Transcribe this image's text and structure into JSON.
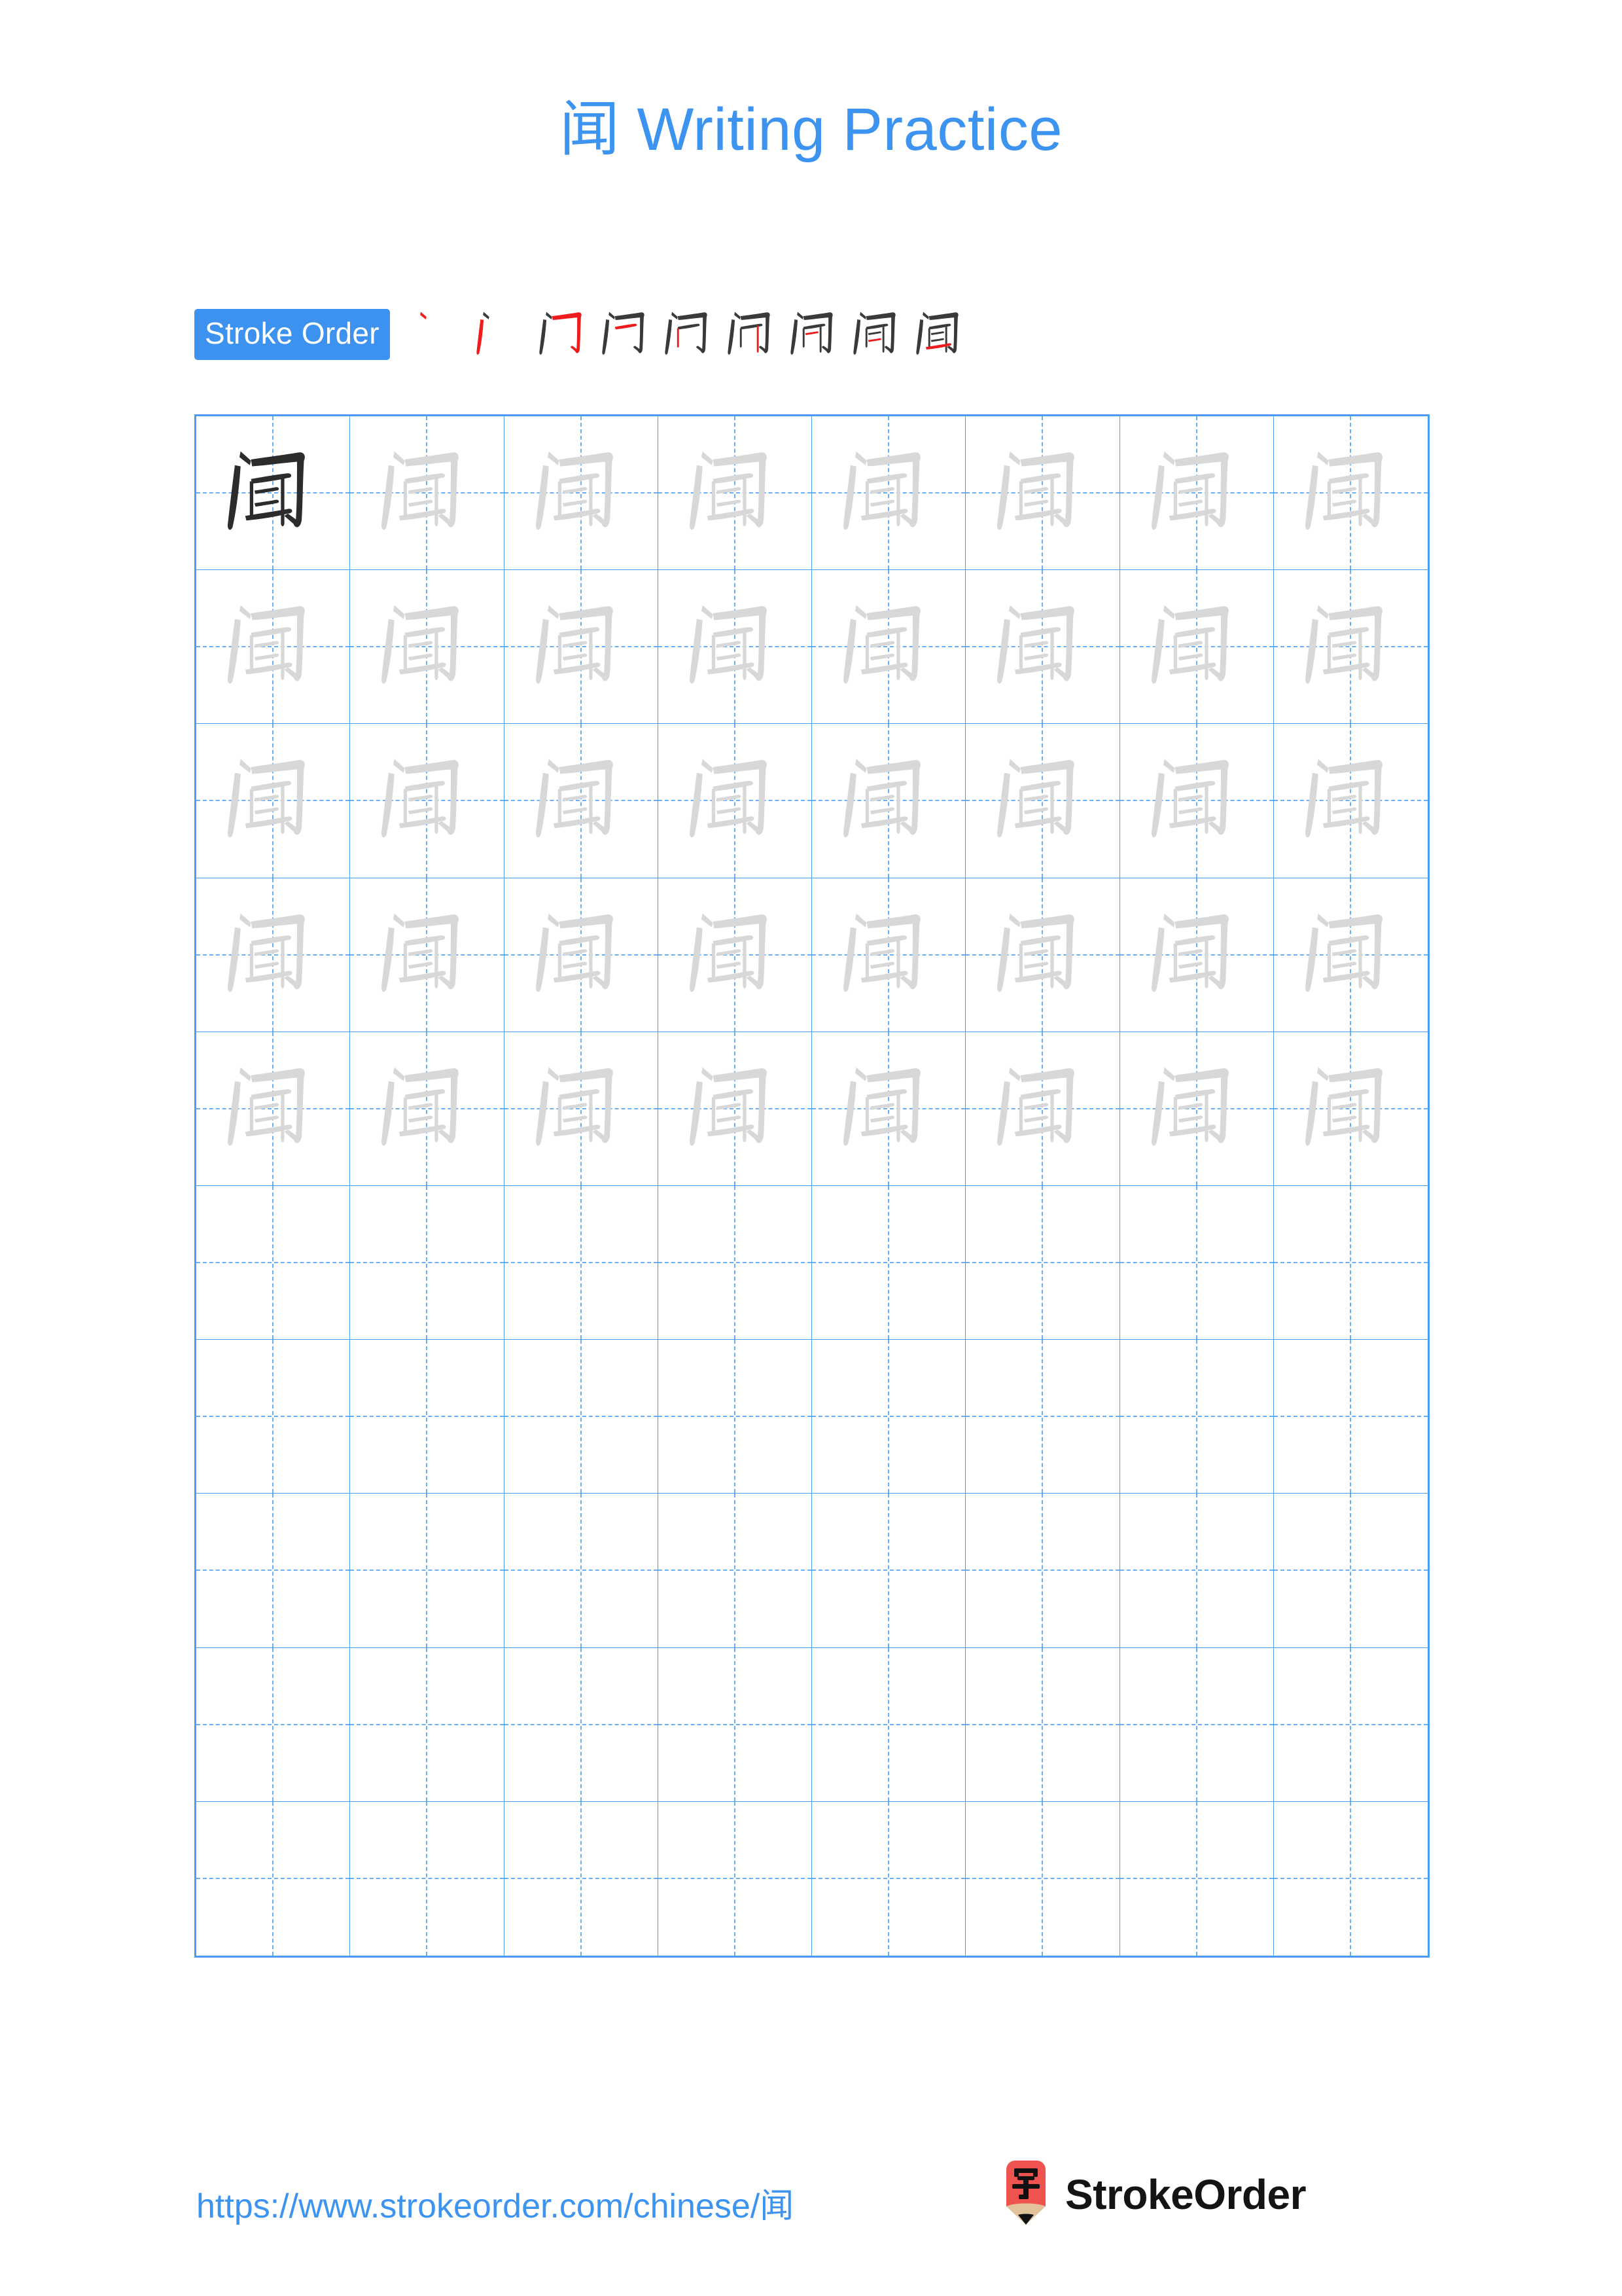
{
  "document": {
    "character": "闻",
    "title": "闻 Writing Practice",
    "title_color": "#3d94f0",
    "page_background": "#ffffff"
  },
  "stroke_order": {
    "badge_label": "Stroke Order",
    "badge_bg_color": "#3d92f0",
    "badge_text_color": "#ffffff",
    "total_strokes": 9,
    "new_stroke_color": "#ee1c1c",
    "existing_stroke_color": "#3a3a3a",
    "steps": [
      {
        "index": 1,
        "label": "丶",
        "description": "dot"
      },
      {
        "index": 2,
        "label": "丿",
        "description": "left vertical of gate radical"
      },
      {
        "index": 3,
        "label": "门",
        "description": "horizontal-fold-hook"
      },
      {
        "index": 4,
        "label": "门",
        "description": "top horizontal of ear component"
      },
      {
        "index": 5,
        "label": "闩",
        "description": "left vertical of ear component"
      },
      {
        "index": 6,
        "label": "闬",
        "description": "right vertical of ear component"
      },
      {
        "index": 7,
        "label": "闻",
        "description": "first inner horizontal"
      },
      {
        "index": 8,
        "label": "闻",
        "description": "second inner horizontal"
      },
      {
        "index": 9,
        "label": "闻",
        "description": "bottom horizontal"
      }
    ]
  },
  "practice_grid": {
    "columns": 8,
    "rows": 10,
    "grid_line_color": "#4a9ef2",
    "guide_line_color": "#6aaef5",
    "model_character_color": "#2c2c2c",
    "trace_character_color": "#d8d8d8",
    "filled_rows": 5,
    "blank_rows": 5,
    "cells": [
      [
        "model",
        "trace",
        "trace",
        "trace",
        "trace",
        "trace",
        "trace",
        "trace"
      ],
      [
        "trace",
        "trace",
        "trace",
        "trace",
        "trace",
        "trace",
        "trace",
        "trace"
      ],
      [
        "trace",
        "trace",
        "trace",
        "trace",
        "trace",
        "trace",
        "trace",
        "trace"
      ],
      [
        "trace",
        "trace",
        "trace",
        "trace",
        "trace",
        "trace",
        "trace",
        "trace"
      ],
      [
        "trace",
        "trace",
        "trace",
        "trace",
        "trace",
        "trace",
        "trace",
        "trace"
      ],
      [
        "blank",
        "blank",
        "blank",
        "blank",
        "blank",
        "blank",
        "blank",
        "blank"
      ],
      [
        "blank",
        "blank",
        "blank",
        "blank",
        "blank",
        "blank",
        "blank",
        "blank"
      ],
      [
        "blank",
        "blank",
        "blank",
        "blank",
        "blank",
        "blank",
        "blank",
        "blank"
      ],
      [
        "blank",
        "blank",
        "blank",
        "blank",
        "blank",
        "blank",
        "blank",
        "blank"
      ],
      [
        "blank",
        "blank",
        "blank",
        "blank",
        "blank",
        "blank",
        "blank",
        "blank"
      ]
    ]
  },
  "footer": {
    "url_text": "https://www.strokeorder.com/chinese/闻",
    "url_color": "#3d94f0",
    "brand_name": "StrokeOrder",
    "brand_name_color": "#141414",
    "logo_character": "字",
    "logo_body_color": "#ef5350",
    "logo_wood_color": "#e2c29a",
    "logo_tip_color": "#111111"
  }
}
